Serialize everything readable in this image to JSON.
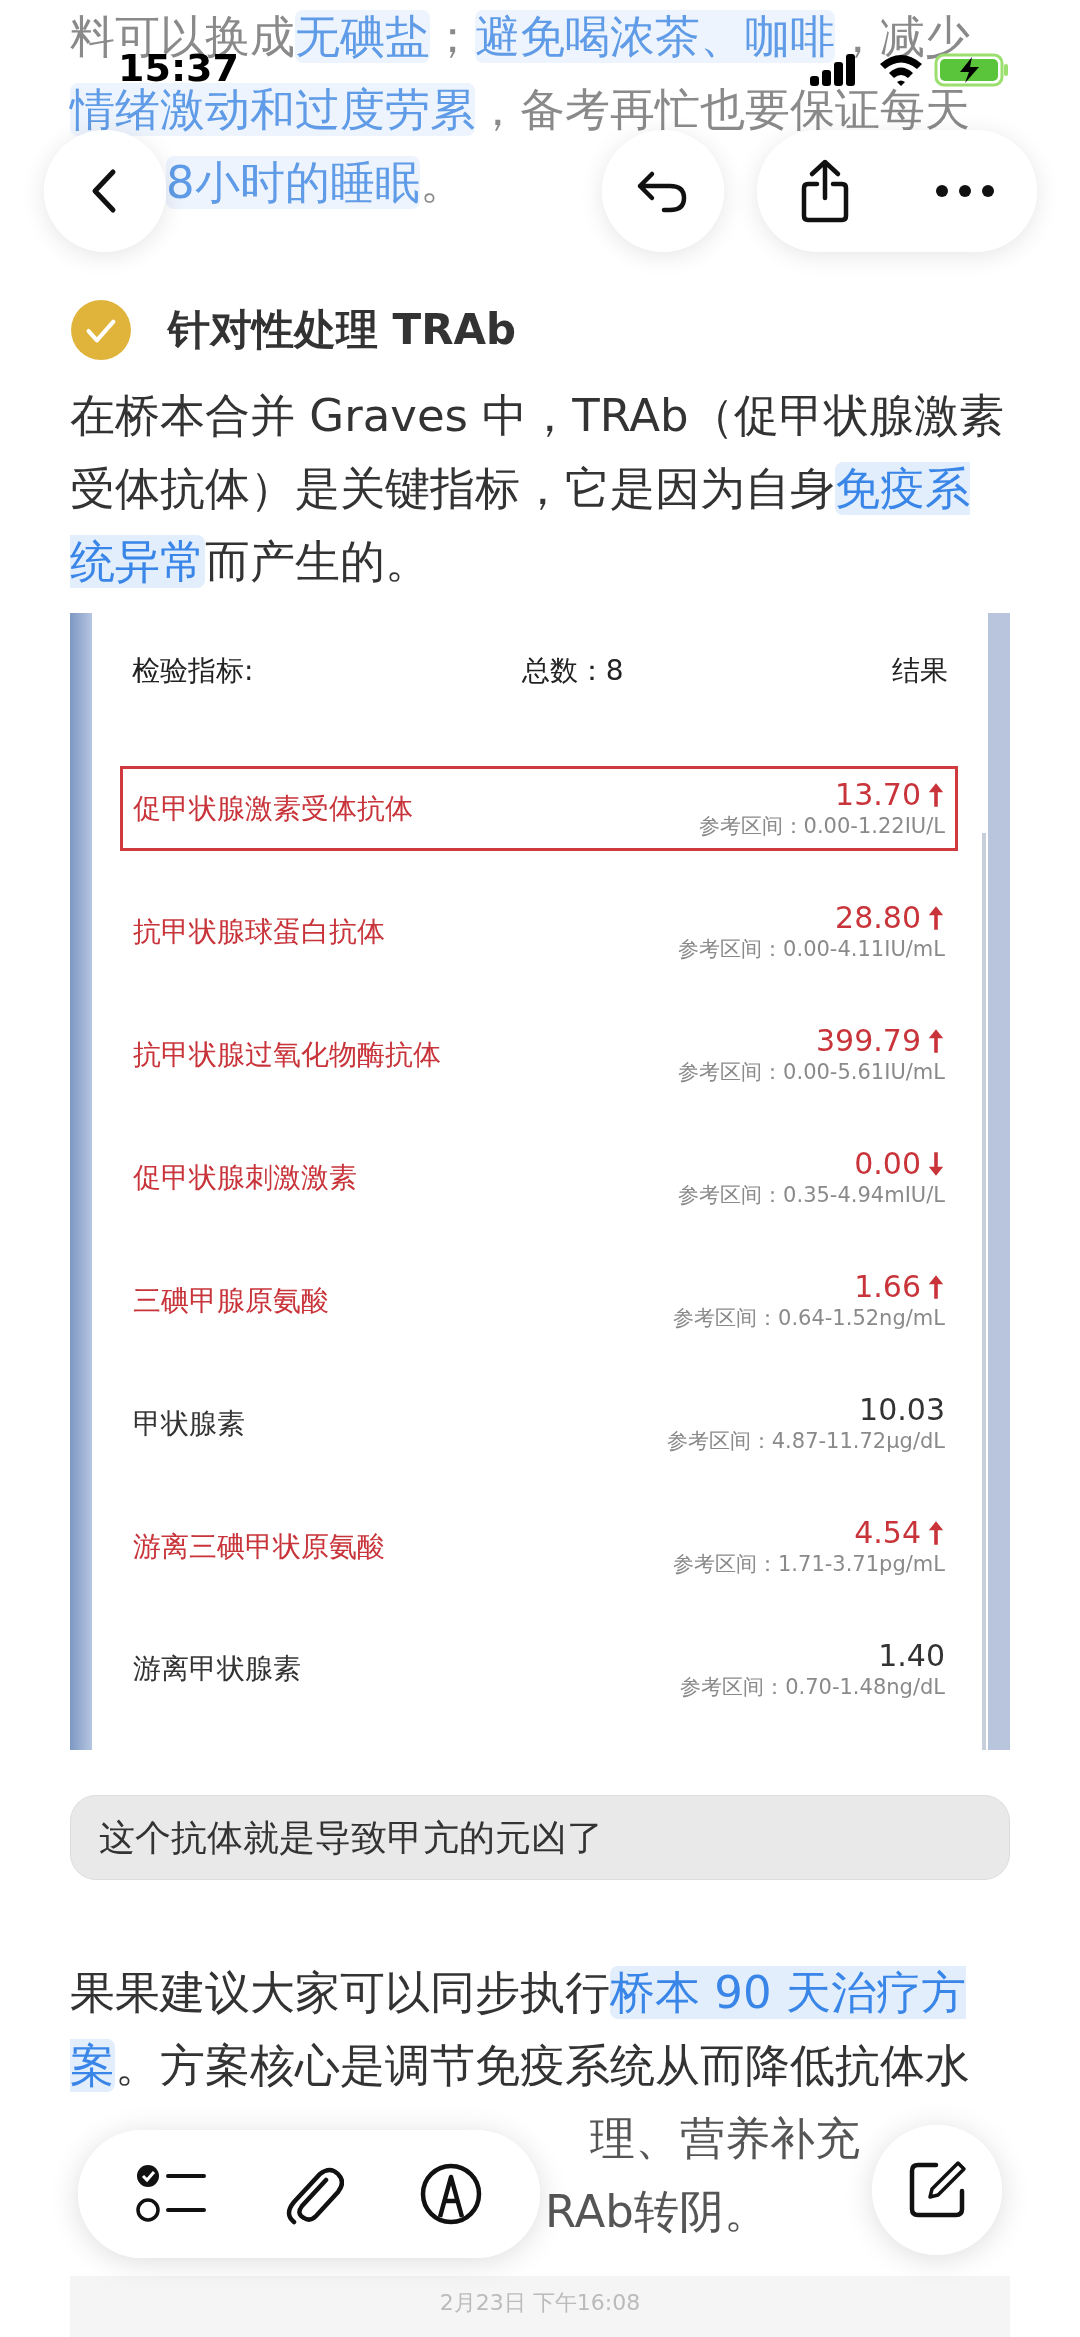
{
  "status_bar": {
    "time": "15:37"
  },
  "intro": [
    {
      "text": "料可以换成",
      "link": false
    },
    {
      "text": "无碘盐",
      "link": true
    },
    {
      "text": "；",
      "link": false
    },
    {
      "text": "避免喝浓茶、咖啡",
      "link": true
    },
    {
      "text": "，减少",
      "link": false
    },
    {
      "text": "情绪激动和过度劳累",
      "link": true
    },
    {
      "text": "，备考再忙也要保证每天",
      "link": false
    },
    {
      "text": "8小时的睡眠",
      "link": true
    },
    {
      "text": "。",
      "link": false
    }
  ],
  "heading": {
    "text": "针对性处理 TRAb",
    "checked": true
  },
  "paragraph": [
    {
      "text": "在桥本合并 Graves 中，TRAb（促甲状腺激素受体抗体）是关键指标，它是因为自身",
      "link": false
    },
    {
      "text": "免疫系统异常",
      "link": true
    },
    {
      "text": "而产生的。",
      "link": false
    }
  ],
  "lab_report": {
    "col_indicator": "检验指标:",
    "total": "总数：8",
    "col_result": "结果",
    "rows": [
      {
        "name": "促甲状腺激素受体抗体",
        "value": "13.70",
        "range": "参考区间：0.00-1.22IU/L",
        "kind": "high",
        "selected": true
      },
      {
        "name": "抗甲状腺球蛋白抗体",
        "value": "28.80",
        "range": "参考区间：0.00-4.11IU/mL",
        "kind": "high",
        "selected": false
      },
      {
        "name": "抗甲状腺过氧化物酶抗体",
        "value": "399.79",
        "range": "参考区间：0.00-5.61IU/mL",
        "kind": "high",
        "selected": false
      },
      {
        "name": "促甲状腺刺激激素",
        "value": "0.00",
        "range": "参考区间：0.35-4.94mIU/L",
        "kind": "low",
        "selected": false
      },
      {
        "name": "三碘甲腺原氨酸",
        "value": "1.66",
        "range": "参考区间：0.64-1.52ng/mL",
        "kind": "high",
        "selected": false
      },
      {
        "name": "甲状腺素",
        "value": "10.03",
        "range": "参考区间：4.87-11.72μg/dL",
        "kind": "normal",
        "selected": false
      },
      {
        "name": "游离三碘甲状原氨酸",
        "value": "4.54",
        "range": "参考区间：1.71-3.71pg/mL",
        "kind": "high",
        "selected": false
      },
      {
        "name": "游离甲状腺素",
        "value": "1.40",
        "range": "参考区间：0.70-1.48ng/dL",
        "kind": "normal",
        "selected": false
      }
    ]
  },
  "quote": "这个抗体就是导致甲亢的元凶了",
  "advice": [
    {
      "text": "果果建议大家可以同步执行",
      "link": false
    },
    {
      "text": "桥本 90 天治疗方案",
      "link": true
    },
    {
      "text": "。方案核心是调节免疫系统从而降低抗体水",
      "link": false
    }
  ],
  "advice_visible_tail": [
    "理、营养补充",
    "RAb转阴。"
  ],
  "timestamp": "2月23日 下午16:08"
}
